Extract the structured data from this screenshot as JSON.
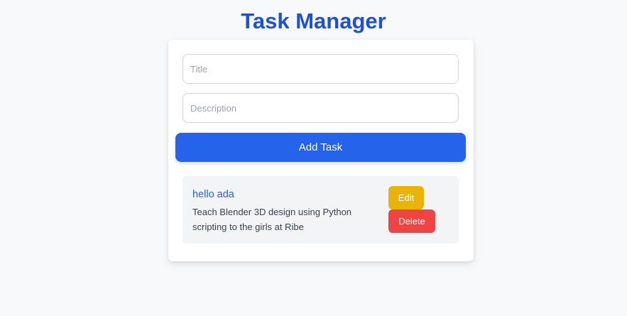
{
  "app": {
    "title": "Task Manager"
  },
  "form": {
    "title_placeholder": "Title",
    "title_value": "",
    "description_placeholder": "Description",
    "description_value": "",
    "add_label": "Add Task"
  },
  "tasks": [
    {
      "title": "hello ada",
      "description": "Teach Blender 3D design using Python scripting to the girls at Ribe",
      "edit_label": "Edit",
      "delete_label": "Delete"
    }
  ],
  "colors": {
    "accent": "#2563eb",
    "title": "#1e4fd8",
    "edit": "#eab308",
    "delete": "#ef4444"
  }
}
